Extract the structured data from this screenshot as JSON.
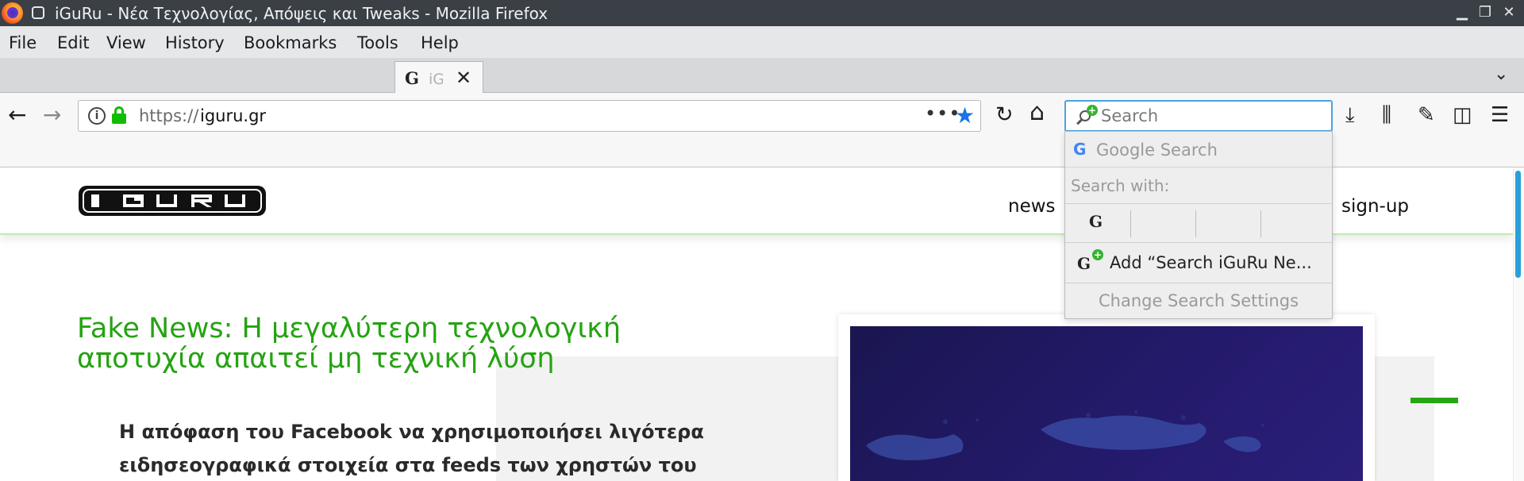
{
  "window": {
    "title": "iGuRu - Νέα Τεχνολογίας, Απόψεις και Tweaks - Mozilla Firefox",
    "minimize_glyph": "▁",
    "maximize_glyph": "❐",
    "close_glyph": "✕"
  },
  "menu": {
    "file": "File",
    "edit": "Edit",
    "view": "View",
    "history": "History",
    "bookmarks": "Bookmarks",
    "tools": "Tools",
    "help": "Help"
  },
  "tabs": [
    {
      "favicon": "G",
      "label": "iGuRu",
      "close_glyph": "✕"
    }
  ],
  "tabstrip": {
    "list_all_glyph": "⌄"
  },
  "nav": {
    "back_glyph": "←",
    "forward_glyph": "→",
    "reload_glyph": "↻",
    "home_glyph": "⌂",
    "info_glyph": "i",
    "page_actions_glyph": "•••",
    "bookmark_star_glyph": "★"
  },
  "urlbar": {
    "prefix": "https://",
    "host": "iguru.gr"
  },
  "search": {
    "placeholder": "Search",
    "plus_glyph": "+"
  },
  "toolbar": {
    "download_glyph": "⤓",
    "library_glyph": "⫼",
    "dropper_glyph": "✎",
    "sidebar_glyph": "◫",
    "menu_glyph": "☰"
  },
  "search_dropdown": {
    "google_icon": "G",
    "google_label": "Google Search",
    "search_with": "Search with:",
    "engine_icon": "G",
    "add_engine": "Add “Search iGuRu Ne...",
    "settings": "Change Search Settings"
  },
  "site": {
    "logo_text": "iGURU",
    "nav_news": "news",
    "nav_signup": "sign-up",
    "headline": "Fake News: Η μεγαλύτερη τεχνολογική αποτυχία απαιτεί μη τεχνική λύση",
    "excerpt": "Η απόφαση του Facebook να χρησιμοποιήσει λιγότερα ειδησεογραφικά στοιχεία στα feeds των χρηστών του"
  },
  "colors": {
    "accent_green": "#25a312",
    "focus_blue": "#4aa3df",
    "bookmark_blue": "#1a73e8",
    "titlebar_bg": "#3b4046"
  }
}
